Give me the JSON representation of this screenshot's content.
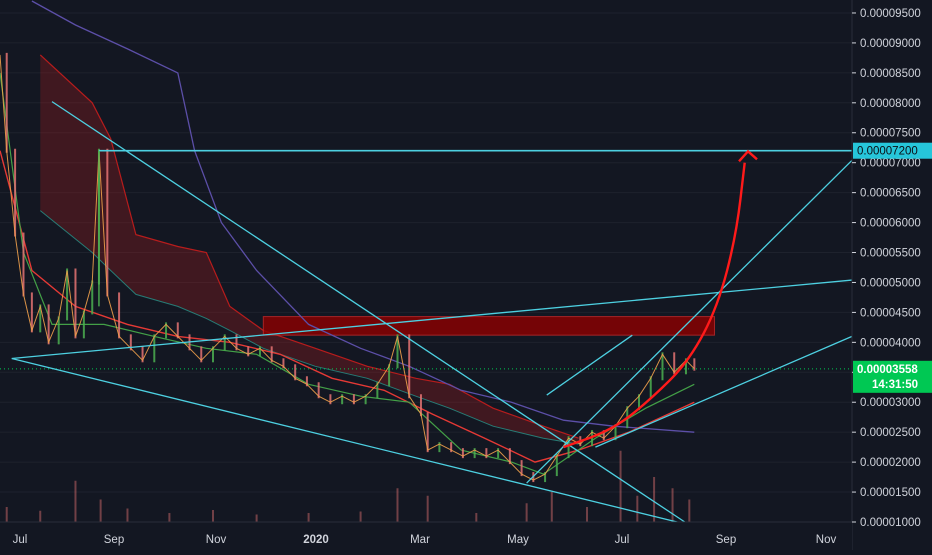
{
  "colors": {
    "background": "#131722",
    "axis_text": "#d1d4dc",
    "axis_text_bold": "#ffffff",
    "grid": "#1e222d",
    "trendline": "#4dd0e1",
    "resistance_zone": "#8b0000",
    "projection_arrow": "#ff1a1a",
    "up_candle": "#4caf50",
    "down_candle": "#e57373",
    "price_tag_bg": "#00c853",
    "target_tag_bg": "#26c6da",
    "ma_red": "#e53935",
    "ma_green": "#43a047",
    "ma_purple": "#5c4fa8",
    "band_teal": "#26a69a",
    "ichimoku_cloud": "#b71c1c"
  },
  "chart_data": {
    "type": "line",
    "y_axis": {
      "ticks": [
        "0.00009500",
        "0.00009000",
        "0.00008500",
        "0.00008000",
        "0.00007500",
        "0.00007000",
        "0.00006500",
        "0.00006000",
        "0.00005500",
        "0.00005000",
        "0.00004500",
        "0.00004000",
        "0.00003500",
        "0.00003000",
        "0.00002500",
        "0.00002000",
        "0.00001500",
        "0.00001000"
      ],
      "ylim": [
        1e-05,
        9.7e-05
      ]
    },
    "x_axis": {
      "ticks": [
        "Jul",
        "Sep",
        "Nov",
        "2020",
        "Mar",
        "May",
        "Jul",
        "Sep",
        "Nov"
      ],
      "xlim": [
        "2019-07-01",
        "2020-11-20"
      ]
    },
    "current_price": {
      "label": "0.00003558",
      "value": 3.558e-05,
      "countdown": "14:31:50"
    },
    "target_price": {
      "label": "0.00007200",
      "value": 7.2e-05,
      "from": "2019-08-29"
    },
    "resistance_zone": {
      "from": "2019-12-05",
      "to": "2020-08-30",
      "low": 4.12e-05,
      "high": 4.43e-05
    },
    "projection": {
      "points": [
        [
          "2020-06-01",
          2.25e-05
        ],
        [
          "2020-07-01",
          2.55e-05
        ],
        [
          "2020-07-25",
          3.1e-05
        ],
        [
          "2020-08-15",
          3.7e-05
        ],
        [
          "2020-09-01",
          4.6e-05
        ],
        [
          "2020-09-12",
          5.8e-05
        ],
        [
          "2020-09-17",
          7e-05
        ]
      ],
      "arrow_tip": [
        "2020-09-19",
        7.19e-05
      ]
    },
    "trendlines": [
      {
        "from": [
          "2019-08-01",
          8.02e-05
        ],
        "to": [
          "2020-08-15",
          9.5e-06
        ]
      },
      {
        "from": [
          "2019-07-08",
          3.73e-05
        ],
        "to": [
          "2020-08-15",
          9.5e-06
        ]
      },
      {
        "from": [
          "2019-07-08",
          3.73e-05
        ],
        "to": [
          "2020-11-20",
          5.04e-05
        ]
      },
      {
        "from": [
          "2020-05-10",
          1.65e-05
        ],
        "to": [
          "2020-11-20",
          7.04e-05
        ]
      },
      {
        "from": [
          "2020-06-20",
          2.25e-05
        ],
        "to": [
          "2020-11-20",
          4.1e-05
        ]
      },
      {
        "from": [
          "2020-05-22",
          3.12e-05
        ],
        "to": [
          "2020-07-12",
          4.12e-05
        ]
      }
    ],
    "price_series": [
      [
        "2019-07-01",
        8.8e-05
      ],
      [
        "2019-07-05",
        7.2e-05
      ],
      [
        "2019-07-10",
        5.8e-05
      ],
      [
        "2019-07-15",
        4.8e-05
      ],
      [
        "2019-07-20",
        4.2e-05
      ],
      [
        "2019-07-25",
        4.6e-05
      ],
      [
        "2019-07-30",
        4e-05
      ],
      [
        "2019-08-05",
        4.4e-05
      ],
      [
        "2019-08-10",
        5.2e-05
      ],
      [
        "2019-08-15",
        4.1e-05
      ],
      [
        "2019-08-20",
        4.5e-05
      ],
      [
        "2019-08-25",
        5e-05
      ],
      [
        "2019-08-29",
        7.2e-05
      ],
      [
        "2019-09-03",
        4.8e-05
      ],
      [
        "2019-09-10",
        4.1e-05
      ],
      [
        "2019-09-17",
        3.9e-05
      ],
      [
        "2019-09-24",
        3.7e-05
      ],
      [
        "2019-10-01",
        4.1e-05
      ],
      [
        "2019-10-08",
        4.3e-05
      ],
      [
        "2019-10-15",
        4.1e-05
      ],
      [
        "2019-10-22",
        3.9e-05
      ],
      [
        "2019-10-29",
        3.7e-05
      ],
      [
        "2019-11-05",
        3.9e-05
      ],
      [
        "2019-11-12",
        4.1e-05
      ],
      [
        "2019-11-19",
        3.9e-05
      ],
      [
        "2019-11-26",
        3.8e-05
      ],
      [
        "2019-12-03",
        3.9e-05
      ],
      [
        "2019-12-10",
        3.7e-05
      ],
      [
        "2019-12-17",
        3.6e-05
      ],
      [
        "2019-12-24",
        3.4e-05
      ],
      [
        "2019-12-31",
        3.3e-05
      ],
      [
        "2020-01-07",
        3.1e-05
      ],
      [
        "2020-01-14",
        3e-05
      ],
      [
        "2020-01-21",
        3.1e-05
      ],
      [
        "2020-01-28",
        3e-05
      ],
      [
        "2020-02-04",
        3.1e-05
      ],
      [
        "2020-02-11",
        3.3e-05
      ],
      [
        "2020-02-18",
        3.6e-05
      ],
      [
        "2020-02-23",
        4.1e-05
      ],
      [
        "2020-03-01",
        3.1e-05
      ],
      [
        "2020-03-08",
        2.8e-05
      ],
      [
        "2020-03-12",
        2.2e-05
      ],
      [
        "2020-03-19",
        2.3e-05
      ],
      [
        "2020-03-26",
        2.2e-05
      ],
      [
        "2020-04-02",
        2.1e-05
      ],
      [
        "2020-04-09",
        2.2e-05
      ],
      [
        "2020-04-16",
        2.1e-05
      ],
      [
        "2020-04-23",
        2.2e-05
      ],
      [
        "2020-04-30",
        2e-05
      ],
      [
        "2020-05-07",
        1.8e-05
      ],
      [
        "2020-05-14",
        1.7e-05
      ],
      [
        "2020-05-21",
        1.8e-05
      ],
      [
        "2020-05-28",
        2.1e-05
      ],
      [
        "2020-06-04",
        2.4e-05
      ],
      [
        "2020-06-11",
        2.3e-05
      ],
      [
        "2020-06-18",
        2.5e-05
      ],
      [
        "2020-06-25",
        2.4e-05
      ],
      [
        "2020-07-02",
        2.6e-05
      ],
      [
        "2020-07-09",
        2.9e-05
      ],
      [
        "2020-07-16",
        3.1e-05
      ],
      [
        "2020-07-23",
        3.4e-05
      ],
      [
        "2020-07-30",
        3.8e-05
      ],
      [
        "2020-08-06",
        3.5e-05
      ],
      [
        "2020-08-13",
        3.7e-05
      ],
      [
        "2020-08-18",
        3.56e-05
      ]
    ],
    "ma_red": [
      [
        "2019-07-01",
        7.2e-05
      ],
      [
        "2019-07-20",
        5.2e-05
      ],
      [
        "2019-08-15",
        4.6e-05
      ],
      [
        "2019-09-15",
        4.3e-05
      ],
      [
        "2019-10-15",
        4.1e-05
      ],
      [
        "2019-11-15",
        4e-05
      ],
      [
        "2019-12-15",
        3.8e-05
      ],
      [
        "2020-01-15",
        3.4e-05
      ],
      [
        "2020-02-15",
        3.2e-05
      ],
      [
        "2020-03-15",
        2.8e-05
      ],
      [
        "2020-04-15",
        2.4e-05
      ],
      [
        "2020-05-15",
        2e-05
      ],
      [
        "2020-06-10",
        2.2e-05
      ],
      [
        "2020-07-10",
        2.5e-05
      ],
      [
        "2020-08-18",
        3e-05
      ]
    ],
    "ma_green": [
      [
        "2019-07-01",
        8.5e-05
      ],
      [
        "2019-07-15",
        5.5e-05
      ],
      [
        "2019-08-01",
        4.3e-05
      ],
      [
        "2019-09-01",
        4.3e-05
      ],
      [
        "2019-10-01",
        4.1e-05
      ],
      [
        "2019-11-01",
        3.9e-05
      ],
      [
        "2019-12-01",
        3.8e-05
      ],
      [
        "2020-01-01",
        3.3e-05
      ],
      [
        "2020-02-01",
        3.1e-05
      ],
      [
        "2020-03-01",
        3e-05
      ],
      [
        "2020-04-01",
        2.2e-05
      ],
      [
        "2020-05-01",
        2e-05
      ],
      [
        "2020-05-20",
        1.8e-05
      ],
      [
        "2020-06-20",
        2.4e-05
      ],
      [
        "2020-07-20",
        2.9e-05
      ],
      [
        "2020-08-18",
        3.3e-05
      ]
    ],
    "ma_purple": [
      [
        "2019-07-20",
        9.7e-05
      ],
      [
        "2019-08-15",
        9.3e-05
      ],
      [
        "2019-09-15",
        8.9e-05
      ],
      [
        "2019-10-15",
        8.5e-05
      ],
      [
        "2019-10-25",
        7.2e-05
      ],
      [
        "2019-11-10",
        6e-05
      ],
      [
        "2019-12-01",
        5.2e-05
      ],
      [
        "2020-01-01",
        4.3e-05
      ],
      [
        "2020-02-01",
        3.9e-05
      ],
      [
        "2020-03-01",
        3.6e-05
      ],
      [
        "2020-04-01",
        3.2e-05
      ],
      [
        "2020-05-01",
        3e-05
      ],
      [
        "2020-06-01",
        2.7e-05
      ],
      [
        "2020-07-01",
        2.6e-05
      ],
      [
        "2020-08-18",
        2.5e-05
      ]
    ],
    "cloud_top": [
      [
        "2019-07-25",
        8.8e-05
      ],
      [
        "2019-08-25",
        8e-05
      ],
      [
        "2019-09-05",
        7.4e-05
      ],
      [
        "2019-09-20",
        5.8e-05
      ],
      [
        "2019-10-15",
        5.6e-05
      ],
      [
        "2019-11-01",
        5.5e-05
      ],
      [
        "2019-11-15",
        4.6e-05
      ],
      [
        "2019-12-05",
        4.2e-05
      ],
      [
        "2020-01-05",
        3.9e-05
      ],
      [
        "2020-02-05",
        3.6e-05
      ],
      [
        "2020-03-05",
        3.4e-05
      ],
      [
        "2020-03-25",
        3.3e-05
      ],
      [
        "2020-04-20",
        2.9e-05
      ],
      [
        "2020-05-20",
        2.6e-05
      ],
      [
        "2020-06-10",
        2.4e-05
      ]
    ],
    "cloud_bottom": [
      [
        "2019-07-25",
        6.2e-05
      ],
      [
        "2019-08-25",
        5.5e-05
      ],
      [
        "2019-09-05",
        5.2e-05
      ],
      [
        "2019-09-20",
        4.8e-05
      ],
      [
        "2019-10-15",
        4.6e-05
      ],
      [
        "2019-11-01",
        4.4e-05
      ],
      [
        "2019-11-15",
        4.2e-05
      ],
      [
        "2019-12-05",
        3.9e-05
      ],
      [
        "2020-01-05",
        3.6e-05
      ],
      [
        "2020-02-05",
        3.4e-05
      ],
      [
        "2020-03-05",
        3.1e-05
      ],
      [
        "2020-03-25",
        2.9e-05
      ],
      [
        "2020-04-20",
        2.6e-05
      ],
      [
        "2020-05-20",
        2.4e-05
      ],
      [
        "2020-06-10",
        2.3e-05
      ]
    ],
    "volume": [
      [
        "2019-07-05",
        0.2
      ],
      [
        "2019-07-25",
        0.15
      ],
      [
        "2019-08-15",
        0.55
      ],
      [
        "2019-08-30",
        0.3
      ],
      [
        "2019-09-15",
        0.18
      ],
      [
        "2019-10-10",
        0.12
      ],
      [
        "2019-11-05",
        0.16
      ],
      [
        "2019-12-01",
        0.1
      ],
      [
        "2020-01-01",
        0.12
      ],
      [
        "2020-02-01",
        0.14
      ],
      [
        "2020-02-23",
        0.45
      ],
      [
        "2020-03-12",
        0.35
      ],
      [
        "2020-04-10",
        0.12
      ],
      [
        "2020-05-10",
        0.25
      ],
      [
        "2020-05-25",
        0.4
      ],
      [
        "2020-06-15",
        0.2
      ],
      [
        "2020-07-05",
        0.95
      ],
      [
        "2020-07-15",
        0.35
      ],
      [
        "2020-07-25",
        0.6
      ],
      [
        "2020-08-05",
        0.45
      ],
      [
        "2020-08-15",
        0.3
      ]
    ]
  }
}
